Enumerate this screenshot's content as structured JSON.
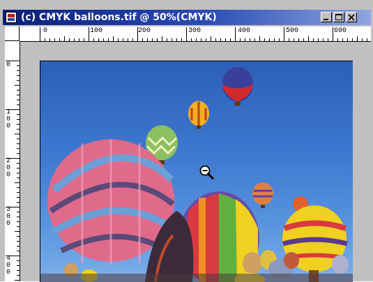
{
  "window": {
    "title": "(c) CMYK balloons.tif @ 50%(CMYK)",
    "controls": [
      "minimize",
      "maximize",
      "close"
    ]
  },
  "rulers": {
    "horizontal_labels": [
      "0",
      "100",
      "200",
      "300",
      "400",
      "500",
      "600"
    ],
    "vertical_labels": [
      "0",
      "100",
      "200",
      "300",
      "400"
    ]
  },
  "document": {
    "file": "(c) CMYK balloons.tif",
    "zoom": "50%",
    "mode": "CMYK"
  },
  "tool": {
    "cursor": "zoom-out-icon"
  }
}
